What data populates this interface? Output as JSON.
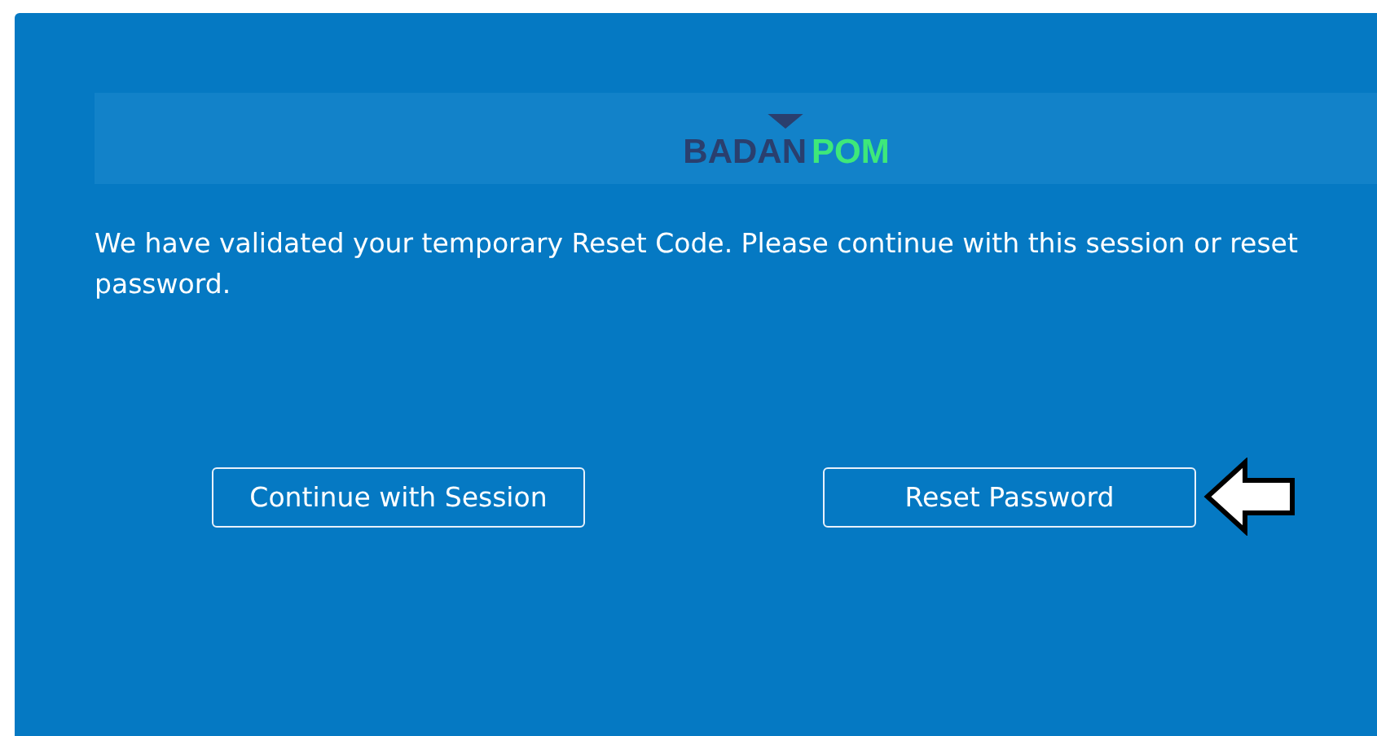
{
  "logo": {
    "parts": [
      {
        "text": "BADAN",
        "color": "#2a3f6e"
      },
      {
        "text": "POM",
        "color": "#3ee87a"
      }
    ]
  },
  "message": "We have validated your temporary Reset Code. Please continue with this session or reset password.",
  "buttons": [
    {
      "label": "Continue with Session",
      "pointed": false
    },
    {
      "label": "Reset Password",
      "pointed": true
    }
  ]
}
